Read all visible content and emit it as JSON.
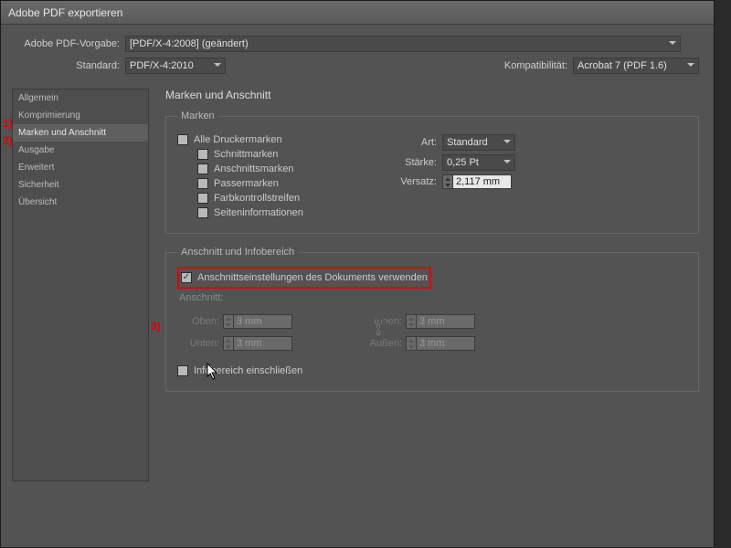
{
  "window": {
    "title": "Adobe PDF exportieren"
  },
  "top": {
    "preset_label": "Adobe PDF-Vorgabe:",
    "preset_value": "[PDF/X-4:2008] (geändert)",
    "standard_label": "Standard:",
    "standard_value": "PDF/X-4:2010",
    "compat_label": "Kompatibilität:",
    "compat_value": "Acrobat 7 (PDF 1.6)"
  },
  "sidebar": {
    "items": [
      {
        "label": "Allgemein"
      },
      {
        "label": "Komprimierung"
      },
      {
        "label": "Marken und Anschnitt"
      },
      {
        "label": "Ausgabe"
      },
      {
        "label": "Erweitert"
      },
      {
        "label": "Sicherheit"
      },
      {
        "label": "Übersicht"
      }
    ]
  },
  "main": {
    "heading": "Marken und Anschnitt",
    "marks": {
      "legend": "Marken",
      "all": "Alle Druckermarken",
      "crop": "Schnittmarken",
      "bleedm": "Anschnittsmarken",
      "reg": "Passermarken",
      "color": "Farbkontrollstreifen",
      "page": "Seiteninformationen",
      "type_lbl": "Art:",
      "type_val": "Standard",
      "weight_lbl": "Stärke:",
      "weight_val": "0,25 Pt",
      "offset_lbl": "Versatz:",
      "offset_val": "2,117 mm"
    },
    "bleed": {
      "legend": "Anschnitt und Infobereich",
      "usedoc": "Anschnittseinstellungen des Dokuments verwenden",
      "sub": "Anschnitt:",
      "top": "Oben:",
      "bottom": "Unten:",
      "inside": "Innen:",
      "outside": "Außen:",
      "val": "3 mm",
      "slug": "Infobereich einschließen"
    }
  },
  "annot": {
    "n1": "1)",
    "n2": "2)",
    "n3": "3)"
  }
}
